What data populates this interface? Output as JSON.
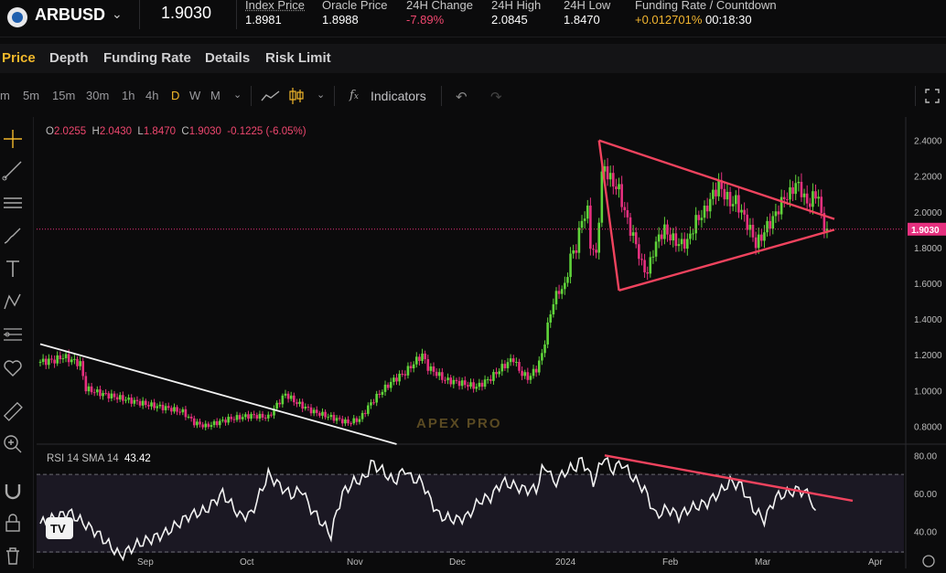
{
  "header": {
    "symbol": "ARBUSD",
    "last_price": "1.9030",
    "stats": [
      {
        "label": "Index Price",
        "value": "1.8981"
      },
      {
        "label": "Oracle Price",
        "value": "1.8988"
      },
      {
        "label": "24H Change",
        "value": "-7.89%"
      },
      {
        "label": "24H High",
        "value": "2.0845"
      },
      {
        "label": "24H Low",
        "value": "1.8470"
      },
      {
        "label": "Funding Rate / Countdown",
        "value": "+0.012701%",
        "value2": "00:18:30"
      }
    ]
  },
  "nav": {
    "tabs": [
      "Price",
      "Depth",
      "Funding Rate",
      "Details",
      "Risk Limit"
    ],
    "active": "Price"
  },
  "toolbar": {
    "timeframes": [
      "m",
      "5m",
      "15m",
      "30m",
      "1h",
      "4h",
      "D",
      "W",
      "M"
    ],
    "active_timeframe": "D",
    "indicators_label": "Indicators"
  },
  "legend": {
    "o_label": "O",
    "o": "2.0255",
    "h_label": "H",
    "h": "2.0430",
    "l_label": "L",
    "l": "1.8470",
    "c_label": "C",
    "c": "1.9030",
    "change": "-0.1225 (-6.05%)"
  },
  "rsi": {
    "label": "RSI 14 SMA 14",
    "value": "43.42",
    "axis": [
      "80.00",
      "60.00",
      "40.00"
    ]
  },
  "watermark": "APEX PRO",
  "tradingview_mark": "TV",
  "colors": {
    "up": "#5fd33a",
    "down": "#e6307f",
    "trend": "#f0435e",
    "accent": "#f2b82b"
  },
  "chart_data": {
    "type": "candlestick",
    "title": "",
    "y_axis": [
      "2.4000",
      "2.2000",
      "2.0000",
      "1.8000",
      "1.6000",
      "1.4000",
      "1.2000",
      "1.0000",
      "0.8000"
    ],
    "ylim": [
      0.71,
      2.48
    ],
    "last_price_label": "1.9030",
    "x_axis": [
      "Sep",
      "Oct",
      "Nov",
      "Dec",
      "2024",
      "Feb",
      "Mar",
      "Apr"
    ],
    "close_path": [
      [
        0,
        1.16
      ],
      [
        5,
        1.17
      ],
      [
        8,
        1.19
      ],
      [
        14,
        1.15
      ],
      [
        16,
        1.01
      ],
      [
        22,
        0.98
      ],
      [
        30,
        0.95
      ],
      [
        38,
        0.92
      ],
      [
        45,
        0.9
      ],
      [
        50,
        0.88
      ],
      [
        54,
        0.82
      ],
      [
        58,
        0.8
      ],
      [
        66,
        0.84
      ],
      [
        74,
        0.86
      ],
      [
        80,
        0.85
      ],
      [
        83,
        0.92
      ],
      [
        86,
        0.98
      ],
      [
        90,
        0.93
      ],
      [
        96,
        0.88
      ],
      [
        102,
        0.85
      ],
      [
        108,
        0.82
      ],
      [
        112,
        0.84
      ],
      [
        116,
        0.93
      ],
      [
        120,
        1.0
      ],
      [
        124,
        1.06
      ],
      [
        128,
        1.1
      ],
      [
        132,
        1.17
      ],
      [
        134,
        1.2
      ],
      [
        136,
        1.13
      ],
      [
        142,
        1.06
      ],
      [
        148,
        1.04
      ],
      [
        153,
        1.02
      ],
      [
        158,
        1.07
      ],
      [
        162,
        1.13
      ],
      [
        166,
        1.18
      ],
      [
        168,
        1.11
      ],
      [
        171,
        1.07
      ],
      [
        174,
        1.12
      ],
      [
        176,
        1.2
      ],
      [
        178,
        1.36
      ],
      [
        180,
        1.5
      ],
      [
        182,
        1.56
      ],
      [
        184,
        1.58
      ],
      [
        186,
        1.75
      ],
      [
        188,
        1.8
      ],
      [
        190,
        1.96
      ],
      [
        192,
        2.0
      ],
      [
        193,
        1.82
      ],
      [
        195,
        1.75
      ],
      [
        197,
        2.2
      ],
      [
        198,
        2.25
      ],
      [
        200,
        2.18
      ],
      [
        203,
        2.12
      ],
      [
        205,
        2.0
      ],
      [
        207,
        1.9
      ],
      [
        209,
        1.82
      ],
      [
        211,
        1.7
      ],
      [
        213,
        1.66
      ],
      [
        215,
        1.78
      ],
      [
        217,
        1.86
      ],
      [
        219,
        1.9
      ],
      [
        221,
        1.86
      ],
      [
        224,
        1.82
      ],
      [
        227,
        1.83
      ],
      [
        230,
        1.95
      ],
      [
        233,
        2.0
      ],
      [
        236,
        2.1
      ],
      [
        238,
        2.15
      ],
      [
        240,
        2.1
      ],
      [
        242,
        2.05
      ],
      [
        244,
        2.06
      ],
      [
        246,
        2.0
      ],
      [
        249,
        1.9
      ],
      [
        251,
        1.82
      ],
      [
        253,
        1.86
      ],
      [
        255,
        1.92
      ],
      [
        257,
        1.96
      ],
      [
        259,
        2.02
      ],
      [
        261,
        2.08
      ],
      [
        263,
        2.1
      ],
      [
        265,
        2.16
      ],
      [
        267,
        2.12
      ],
      [
        269,
        2.04
      ],
      [
        271,
        2.08
      ],
      [
        273,
        2.1
      ],
      [
        274,
        1.96
      ],
      [
        275,
        1.92
      ],
      [
        276,
        1.9
      ]
    ],
    "rsi_path": [
      [
        0,
        44
      ],
      [
        10,
        50
      ],
      [
        20,
        39
      ],
      [
        28,
        27
      ],
      [
        34,
        33
      ],
      [
        44,
        39
      ],
      [
        52,
        48
      ],
      [
        58,
        51
      ],
      [
        64,
        60
      ],
      [
        70,
        48
      ],
      [
        74,
        49
      ],
      [
        80,
        70
      ],
      [
        84,
        64
      ],
      [
        88,
        59
      ],
      [
        92,
        62
      ],
      [
        94,
        54
      ],
      [
        98,
        46
      ],
      [
        102,
        38
      ],
      [
        104,
        50
      ],
      [
        106,
        60
      ],
      [
        110,
        66
      ],
      [
        114,
        68
      ],
      [
        116,
        76
      ],
      [
        120,
        72
      ],
      [
        124,
        66
      ],
      [
        128,
        73
      ],
      [
        130,
        68
      ],
      [
        134,
        66
      ],
      [
        136,
        59
      ],
      [
        140,
        48
      ],
      [
        146,
        46
      ],
      [
        150,
        48
      ],
      [
        154,
        56
      ],
      [
        158,
        58
      ],
      [
        162,
        66
      ],
      [
        166,
        64
      ],
      [
        170,
        62
      ],
      [
        174,
        62
      ],
      [
        176,
        72
      ],
      [
        178,
        74
      ],
      [
        180,
        65
      ],
      [
        184,
        71
      ],
      [
        186,
        73
      ],
      [
        188,
        74
      ],
      [
        190,
        78
      ],
      [
        192,
        72
      ],
      [
        194,
        66
      ],
      [
        196,
        73
      ],
      [
        198,
        80
      ],
      [
        200,
        72
      ],
      [
        204,
        76
      ],
      [
        208,
        68
      ],
      [
        212,
        62
      ],
      [
        216,
        48
      ],
      [
        220,
        52
      ],
      [
        224,
        48
      ],
      [
        228,
        52
      ],
      [
        234,
        55
      ],
      [
        238,
        60
      ],
      [
        242,
        66
      ],
      [
        246,
        64
      ],
      [
        250,
        52
      ],
      [
        254,
        46
      ],
      [
        258,
        58
      ],
      [
        262,
        60
      ],
      [
        266,
        62
      ],
      [
        270,
        59
      ],
      [
        272,
        48
      ]
    ],
    "triangle": [
      [
        196,
        2.4
      ],
      [
        276,
        1.96
      ],
      [
        276,
        1.9
      ],
      [
        203,
        1.56
      ]
    ],
    "support_line": [
      [
        0,
        1.26
      ],
      [
        125,
        0.7
      ]
    ],
    "rsi_trend": [
      [
        198,
        80
      ],
      [
        276,
        58
      ]
    ]
  }
}
